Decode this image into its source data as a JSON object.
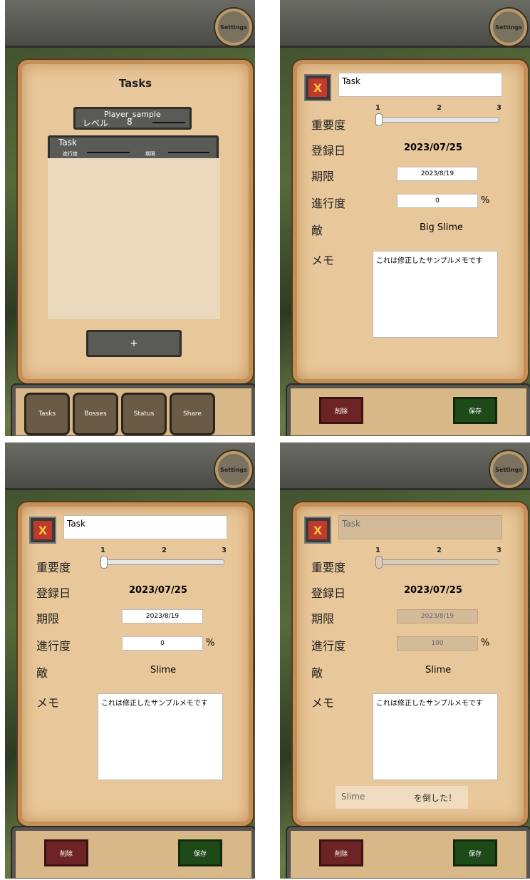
{
  "settings_label": "Settings",
  "screen1": {
    "title": "Tasks",
    "player_name": "Player_sample",
    "level_label": "レベル",
    "level_value": "8",
    "task_header": "Task",
    "progress_label": "進行度",
    "deadline_label": "期限",
    "add_button": "+",
    "nav": [
      "Tasks",
      "Bosses",
      "Status",
      "Share"
    ]
  },
  "form_labels": {
    "importance": "重要度",
    "registered": "登録日",
    "deadline": "期限",
    "progress": "進行度",
    "enemy": "敵",
    "memo": "メモ",
    "percent": "%",
    "ticks": [
      "1",
      "2",
      "3"
    ],
    "close": "X",
    "delete": "削除",
    "save": "保存"
  },
  "screen2": {
    "task_name": "Task",
    "importance": 1,
    "registered": "2023/07/25",
    "deadline": "2023/8/19",
    "progress": "0",
    "enemy": "Big Slime",
    "memo": "これは修正したサンプルメモです"
  },
  "screen3": {
    "task_name": "Task",
    "importance": 1,
    "registered": "2023/07/25",
    "deadline": "2023/8/19",
    "progress": "0",
    "enemy": "Slime",
    "memo": "これは修正したサンプルメモです"
  },
  "screen4": {
    "task_name": "Task",
    "importance": 1,
    "registered": "2023/07/25",
    "deadline": "2023/8/19",
    "progress": "100",
    "enemy": "Slime",
    "memo": "これは修正したサンプルメモです",
    "defeat_enemy": "Slime",
    "defeat_text": "を倒した！"
  }
}
